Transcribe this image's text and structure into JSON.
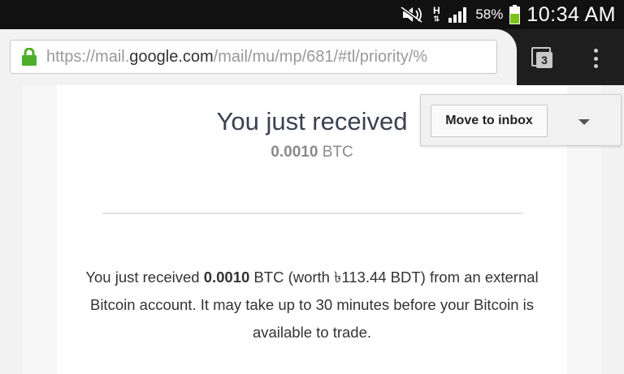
{
  "status_bar": {
    "network_type": "H",
    "battery_percent": "58%",
    "time": "10:34 AM"
  },
  "browser": {
    "url_prefix": "https://mail.",
    "url_domain": "google.com",
    "url_path": "/mail/mu/mp/681/#tl/priority/%",
    "tab_count": "3"
  },
  "email": {
    "headline": "You just received",
    "amount_value": "0.0010",
    "amount_unit": " BTC",
    "body_intro": "You just received ",
    "body_amount": "0.0010",
    "body_rest": " BTC (worth ৳113.44 BDT) from an external Bitcoin account. It may take up to 30 minutes before your Bitcoin is available to trade."
  },
  "actions": {
    "move_to_inbox": "Move to inbox"
  },
  "colors": {
    "lock_green": "#4caf2a",
    "battery_green": "#7cc31c"
  }
}
